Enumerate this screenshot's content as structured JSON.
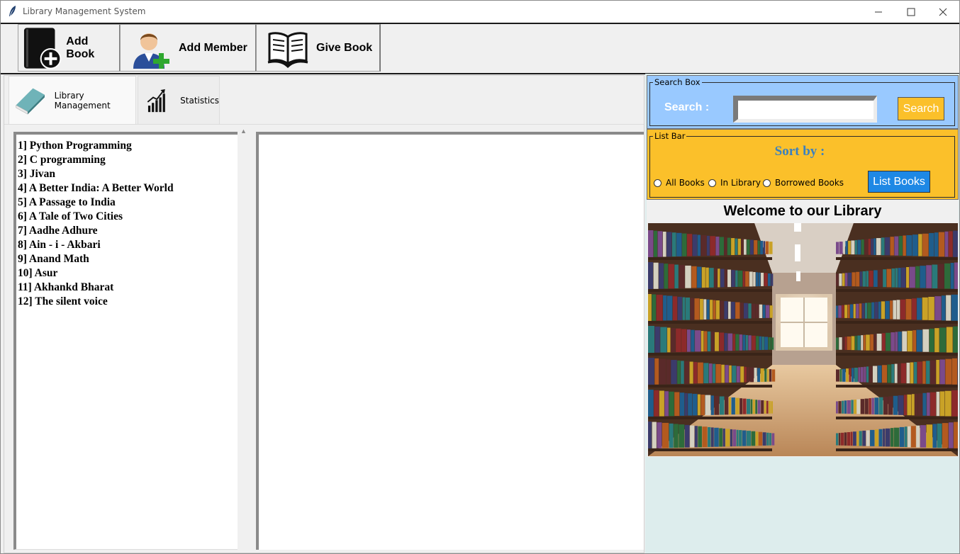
{
  "window": {
    "title": "Library Management System"
  },
  "toolbar": {
    "add_book": "Add Book",
    "add_member": "Add Member",
    "give_book": "Give Book"
  },
  "tabs": [
    {
      "label": "Library Management"
    },
    {
      "label": "Statistics"
    }
  ],
  "books": [
    "1] Python Programming",
    "2] C programming",
    "3] Jivan",
    "4] A Better India: A Better World",
    "5] A Passage to India",
    "6] A Tale of Two Cities",
    "7] Aadhe Adhure",
    "8] Ain - i - Akbari",
    "9] Anand Math",
    "10] Asur",
    "11] Akhankd Bharat",
    "12] The silent voice"
  ],
  "search": {
    "legend": "Search Box",
    "label": "Search :",
    "value": "",
    "button": "Search"
  },
  "listbar": {
    "legend": "List Bar",
    "sort_label": "Sort by :",
    "options": [
      "All Books",
      "In Library",
      "Borrowed Books"
    ],
    "button": "List Books"
  },
  "welcome": "Welcome to our Library",
  "colors": {
    "search_bg": "#99c9ff",
    "listbar_bg": "#fbc02a",
    "list_btn": "#1e88e5",
    "sort_text": "#3a80c0"
  }
}
